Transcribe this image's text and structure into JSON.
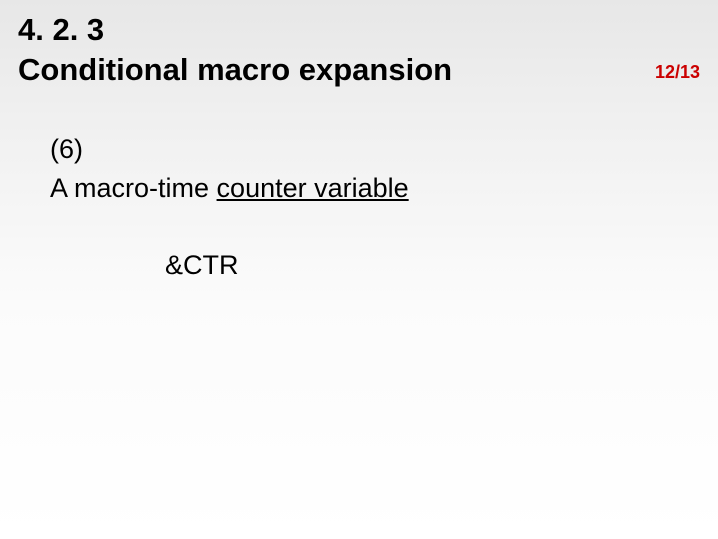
{
  "heading": {
    "section_number": "4. 2. 3",
    "title": "Conditional macro expansion"
  },
  "pager": "12/13",
  "content": {
    "item_label": "(6)",
    "line_prefix": "A macro-time ",
    "line_underlined": "counter variable",
    "variable": "&CTR"
  }
}
